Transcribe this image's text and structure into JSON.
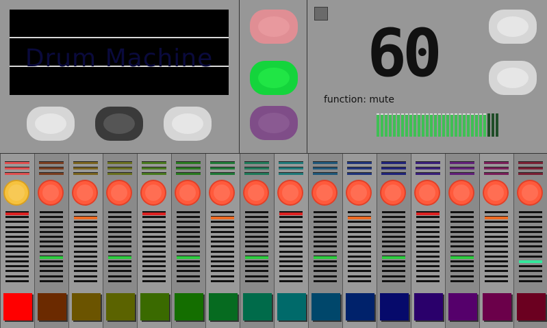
{
  "display": {
    "title": "Drum Machine"
  },
  "tempo": "60",
  "function_label": "function: mute",
  "top_pads": [
    "light",
    "dark",
    "light"
  ],
  "mid_pads": [
    "pink",
    "green",
    "purple"
  ],
  "right_pads": [
    "light",
    "light"
  ],
  "level_meter": {
    "segments": 30,
    "lit": 27
  },
  "channels": [
    {
      "color": "#ff0000",
      "line": "#e05050",
      "knob": "#f6c23e",
      "marker_color": "#dd2222",
      "marker_level": 0.98
    },
    {
      "color": "#6b2a00",
      "line": "#7a3e20",
      "knob": "#ff5a3c",
      "marker_color": "#2ecc40",
      "marker_level": 0.38
    },
    {
      "color": "#6b5400",
      "line": "#7a6420",
      "knob": "#ff5a3c",
      "marker_color": "#ee6a22",
      "marker_level": 0.92
    },
    {
      "color": "#5b6300",
      "line": "#6a7020",
      "knob": "#ff5a3c",
      "marker_color": "#2ecc40",
      "marker_level": 0.38
    },
    {
      "color": "#3a6a00",
      "line": "#4a7a20",
      "knob": "#ff5a3c",
      "marker_color": "#dd2222",
      "marker_level": 0.98
    },
    {
      "color": "#146e00",
      "line": "#2a7a20",
      "knob": "#ff5a3c",
      "marker_color": "#2ecc40",
      "marker_level": 0.38
    },
    {
      "color": "#066b20",
      "line": "#207a38",
      "knob": "#ff5a3c",
      "marker_color": "#ee6a22",
      "marker_level": 0.92
    },
    {
      "color": "#006b4a",
      "line": "#207a5a",
      "knob": "#ff5a3c",
      "marker_color": "#2ecc40",
      "marker_level": 0.38
    },
    {
      "color": "#006a6a",
      "line": "#207a7a",
      "knob": "#ff5a3c",
      "marker_color": "#dd2222",
      "marker_level": 0.98
    },
    {
      "color": "#00476b",
      "line": "#20587a",
      "knob": "#ff5a3c",
      "marker_color": "#2ecc40",
      "marker_level": 0.38
    },
    {
      "color": "#00226b",
      "line": "#20347a",
      "knob": "#ff5a3c",
      "marker_color": "#ee6a22",
      "marker_level": 0.92
    },
    {
      "color": "#060a6b",
      "line": "#20247a",
      "knob": "#ff5a3c",
      "marker_color": "#2ecc40",
      "marker_level": 0.38
    },
    {
      "color": "#2a006b",
      "line": "#3a207a",
      "knob": "#ff5a3c",
      "marker_color": "#dd2222",
      "marker_level": 0.98
    },
    {
      "color": "#55006b",
      "line": "#62207a",
      "knob": "#ff5a3c",
      "marker_color": "#2ecc40",
      "marker_level": 0.38
    },
    {
      "color": "#6b004a",
      "line": "#7a205a",
      "knob": "#ff5a3c",
      "marker_color": "#ee6a22",
      "marker_level": 0.92
    },
    {
      "color": "#6b0020",
      "line": "#7a2034",
      "knob": "#ff5a3c",
      "marker_color": "#33e89c",
      "marker_level": 0.32
    }
  ]
}
